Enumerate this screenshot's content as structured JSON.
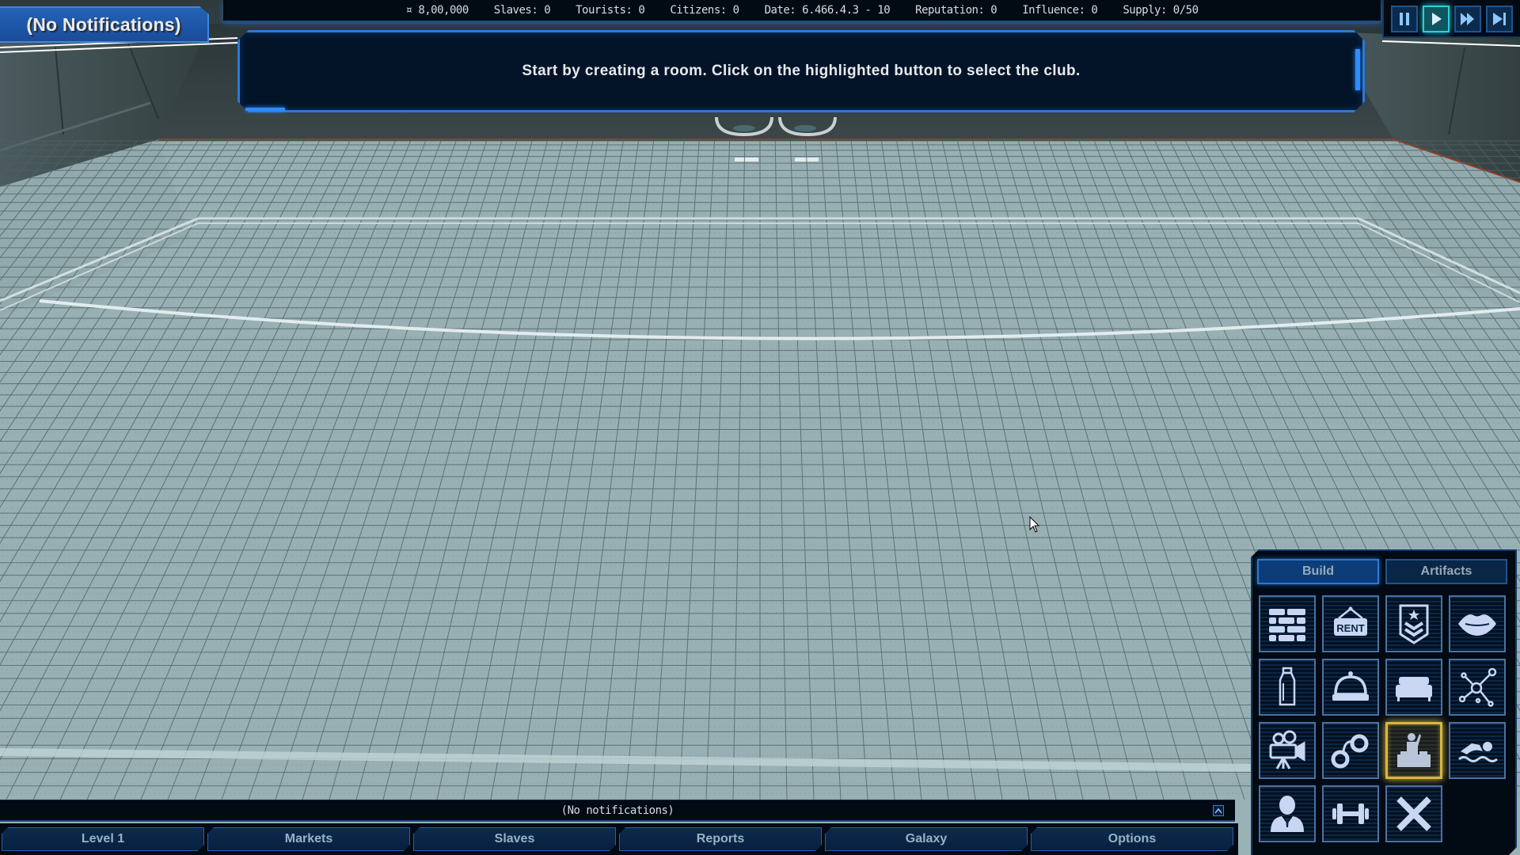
{
  "notifications_tab": {
    "label": "(No Notifications)"
  },
  "status_bar": {
    "money": "¤ 8,00,000",
    "slaves": "Slaves: 0",
    "tourists": "Tourists: 0",
    "citizens": "Citizens: 0",
    "date": "Date: 6.466.4.3 - 10",
    "reputation": "Reputation: 0",
    "influence": "Influence: 0",
    "supply": "Supply: 0/50"
  },
  "speed_controls": [
    {
      "name": "pause",
      "icon": "pause-icon",
      "active": false
    },
    {
      "name": "play",
      "icon": "play-icon",
      "active": true
    },
    {
      "name": "fast-forward",
      "icon": "fast-forward-icon",
      "active": false
    },
    {
      "name": "skip",
      "icon": "skip-forward-icon",
      "active": false
    }
  ],
  "tutorial": {
    "message": "Start by creating a room. Click on the highlighted button to select the club."
  },
  "bottom_notifications": {
    "label": "(No notifications)",
    "expand_icon": "chevron-up-icon"
  },
  "bottom_nav": [
    {
      "label": "Level 1"
    },
    {
      "label": "Markets"
    },
    {
      "label": "Slaves"
    },
    {
      "label": "Reports"
    },
    {
      "label": "Galaxy"
    },
    {
      "label": "Options"
    }
  ],
  "build_panel": {
    "tabs": [
      {
        "label": "Build",
        "active": true
      },
      {
        "label": "Artifacts",
        "active": false
      }
    ],
    "tiles": [
      {
        "icon": "brick-wall-icon",
        "rent_text": ""
      },
      {
        "icon": "rent-sign-icon",
        "rent_text": "RENT"
      },
      {
        "icon": "rank-badge-icon",
        "rent_text": ""
      },
      {
        "icon": "lips-icon",
        "rent_text": ""
      },
      {
        "icon": "milk-bottle-icon",
        "rent_text": ""
      },
      {
        "icon": "service-bell-icon",
        "rent_text": ""
      },
      {
        "icon": "bed-icon",
        "rent_text": ""
      },
      {
        "icon": "molecule-icon",
        "rent_text": ""
      },
      {
        "icon": "movie-camera-icon",
        "rent_text": ""
      },
      {
        "icon": "handcuffs-icon",
        "rent_text": ""
      },
      {
        "icon": "dj-club-icon",
        "rent_text": "",
        "highlighted": true
      },
      {
        "icon": "swimmer-icon",
        "rent_text": ""
      },
      {
        "icon": "businessman-icon",
        "rent_text": ""
      },
      {
        "icon": "dumbbell-icon",
        "rent_text": ""
      },
      {
        "icon": "close-x-icon",
        "rent_text": ""
      }
    ]
  },
  "colors": {
    "accent_blue": "#2e8cff",
    "highlight_gold": "#d8b640",
    "active_teal": "#2ad0d8",
    "floor": "#98b0b4",
    "panel_bg": "#020a14"
  }
}
